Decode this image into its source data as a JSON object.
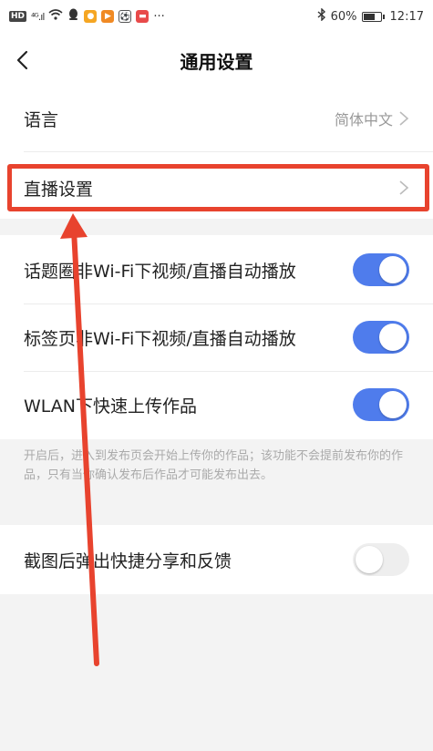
{
  "status_bar": {
    "network_badge": "HD",
    "signal_text": "⁴ᴳ.ıl",
    "battery_text": "60%",
    "time": "12:17",
    "more": "···"
  },
  "header": {
    "title": "通用设置"
  },
  "language_row": {
    "label": "语言",
    "value": "简体中文"
  },
  "live_row": {
    "label": "直播设置"
  },
  "toggles": [
    {
      "label": "话题圈非Wi-Fi下视频/直播自动播放",
      "on": true
    },
    {
      "label": "标签页非Wi-Fi下视频/直播自动播放",
      "on": true
    },
    {
      "label": "WLAN下快速上传作品",
      "on": true
    }
  ],
  "upload_hint": "开启后，进入到发布页会开始上传你的作品；该功能不会提前发布你的作品，只有当你确认发布后作品才可能发布出去。",
  "screenshot_row": {
    "label": "截图后弹出快捷分享和反馈",
    "on": false
  },
  "colors": {
    "toggle_on": "#4f7cec",
    "annotation_red": "#e8432e"
  }
}
